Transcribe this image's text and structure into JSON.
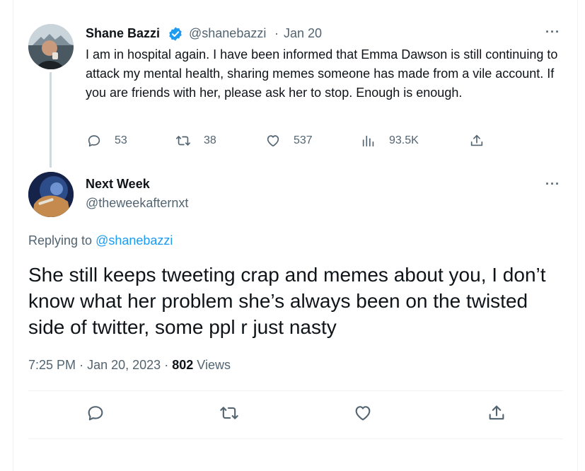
{
  "original_tweet": {
    "author_name": "Shane Bazzi",
    "handle": "@shanebazzi",
    "separator": "·",
    "date": "Jan 20",
    "more": "···",
    "text": "I am in hospital again. I have been informed that Emma Dawson is still continuing to attack my mental health, sharing memes someone has made from a vile account. If you are friends with her, please ask her to stop. Enough is enough.",
    "actions": {
      "replies": "53",
      "retweets": "38",
      "likes": "537",
      "views": "93.5K"
    }
  },
  "reply_tweet": {
    "author_name": "Next Week",
    "handle": "@theweekafternxt",
    "more": "···",
    "replying_prefix": "Replying to",
    "replying_mention": "@shanebazzi",
    "text": "She still keeps tweeting crap and memes about you, I don’t know what her problem she’s always been on the twisted side of twitter, some ppl r just nasty",
    "time": "7:25 PM",
    "dot": "·",
    "date": "Jan 20, 2023",
    "views_count": "802",
    "views_label": "Views"
  },
  "colors": {
    "accent": "#1d9bf0",
    "secondary_text": "#536471",
    "primary_text": "#0f1419"
  },
  "icons": [
    "verified-badge-icon",
    "reply-icon",
    "retweet-icon",
    "like-icon",
    "views-icon",
    "share-icon",
    "more-icon"
  ]
}
